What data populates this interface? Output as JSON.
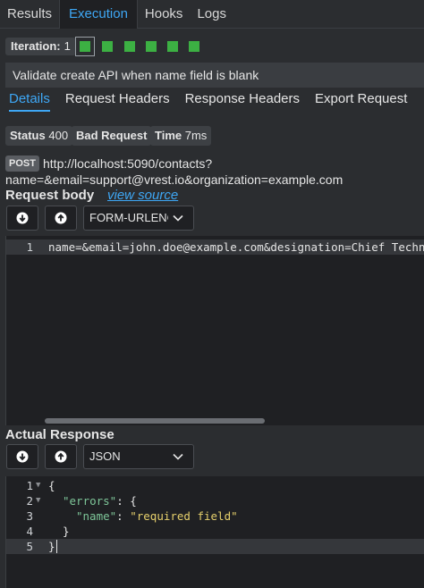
{
  "top_tabs": [
    {
      "label": "Results",
      "active": false
    },
    {
      "label": "Execution",
      "active": true
    },
    {
      "label": "Hooks",
      "active": false
    },
    {
      "label": "Logs",
      "active": false
    }
  ],
  "iteration": {
    "label": "Iteration:",
    "value": "1",
    "count": 6,
    "status_color": "#3cb043"
  },
  "test_case_title": "Validate create API when name field is blank",
  "detail_tabs": [
    {
      "label": "Details",
      "active": true
    },
    {
      "label": "Request Headers",
      "active": false
    },
    {
      "label": "Response Headers",
      "active": false
    },
    {
      "label": "Export Request",
      "active": false
    }
  ],
  "status": {
    "label": "Status",
    "code": "400",
    "text": "Bad Request",
    "time_label": "Time",
    "time_value": "7ms"
  },
  "request": {
    "method": "POST",
    "url_line1": "http://localhost:5090/contacts?",
    "url_line2": "name=&email=support@vrest.io&organization=example.com",
    "body_title": "Request body",
    "view_source": "view source",
    "format": "FORM-URLENCODED",
    "body_lines": [
      {
        "num": "1",
        "text": "name=&email=john.doe@example.com&designation=Chief Technical Officer"
      }
    ]
  },
  "response": {
    "title": "Actual Response",
    "format": "JSON",
    "lines": [
      {
        "num": "1",
        "fold": true,
        "text": "{"
      },
      {
        "num": "2",
        "fold": true,
        "key": "\"errors\"",
        "text": ": {"
      },
      {
        "num": "3",
        "fold": false,
        "key": "\"name\"",
        "text": ": ",
        "str": "\"required field\""
      },
      {
        "num": "4",
        "fold": false,
        "text": "}"
      },
      {
        "num": "5",
        "fold": false,
        "text": "}"
      }
    ]
  },
  "icons": {
    "download": "download-arrow-icon",
    "upload": "upload-arrow-icon",
    "dropdown": "chevron-down-icon",
    "fold": "fold-triangle-icon"
  },
  "colors": {
    "accent": "#3ea7f5",
    "success": "#3cb043",
    "background": "#2b2d30",
    "editor": "#1f2023"
  }
}
